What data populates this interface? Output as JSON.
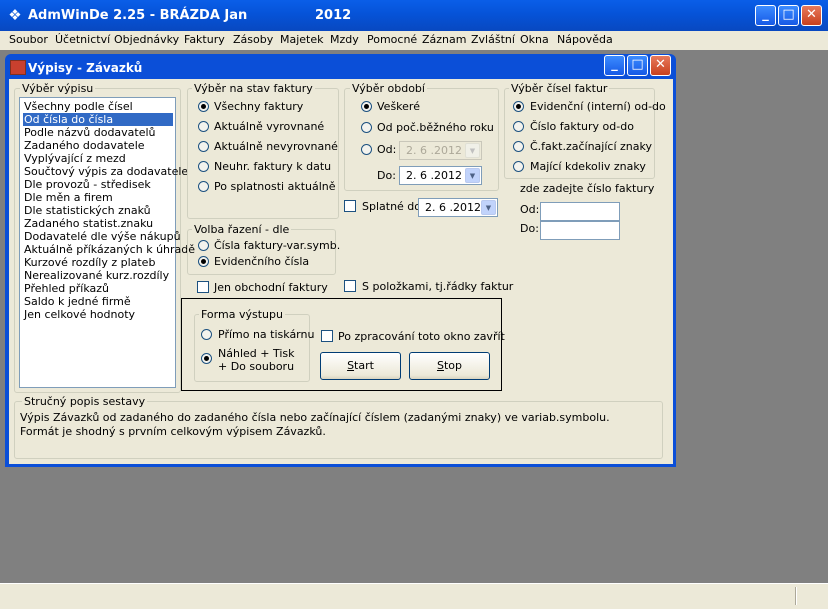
{
  "app": {
    "title": "AdmWinDe 2.25 - BRÁZDA Jan",
    "year": "2012",
    "icon": "app-logo-icon"
  },
  "window_controls": {
    "minimize": "_",
    "maximize": "□",
    "close": "✕"
  },
  "menu": [
    {
      "label": "Soubor"
    },
    {
      "label": "Účetnictví"
    },
    {
      "label": "Objednávky"
    },
    {
      "label": "Faktury"
    },
    {
      "label": "Zásoby"
    },
    {
      "label": "Majetek"
    },
    {
      "label": "Mzdy"
    },
    {
      "label": "Pomocné"
    },
    {
      "label": "Záznam"
    },
    {
      "label": "Zvláštní"
    },
    {
      "label": "Okna"
    },
    {
      "label": "Nápověda"
    }
  ],
  "dialog": {
    "title": "Výpisy - Závazků",
    "report_select": {
      "legend": "Výběr výpisu",
      "items": [
        "Všechny podle čísel",
        "Od čísla do čísla",
        "Podle názvů dodavatelů",
        "Zadaného dodavatele",
        "Vyplývající z mezd",
        "Součtový výpis za dodavatele",
        "Dle provozů - středisek",
        "Dle měn a firem",
        "Dle statistických znaků",
        "Zadaného statist.znaku",
        "Dodavatelé dle výše nákupů",
        "Aktuálně příkázaných k úhradě",
        "Kurzové rozdíly z plateb",
        "Nerealizované kurz.rozdíly",
        "Přehled příkazů",
        "Saldo k jedné firmě",
        "Jen celkové hodnoty"
      ],
      "selected_index": 1
    },
    "invoice_state": {
      "legend": "Výběr na stav faktury",
      "options": [
        "Všechny faktury",
        "Aktuálně vyrovnané",
        "Aktuálně nevyrovnané",
        "Neuhr. faktury k datu",
        "Po splatnosti aktuálně"
      ],
      "selected_index": 0
    },
    "period": {
      "legend": "Výběr období",
      "opt_all": "Veškeré",
      "opt_start": "Od poč.běžného roku",
      "opt_from": "Od:",
      "from_value": "2. 6 .2012",
      "to_label": "Do:",
      "to_value": "2. 6 .2012",
      "selected": "all"
    },
    "invoice_numbers": {
      "legend": "Výběr čísel faktur",
      "options": [
        "Evidenční (interní) od-do",
        "Číslo faktury od-do",
        "Č.fakt.začínající znaky",
        "Mající kdekoliv znaky"
      ],
      "selected_index": 0,
      "enter_hint": "zde zadejte číslo faktury",
      "from_label": "Od:",
      "from_value": "",
      "to_label": "Do:",
      "to_value": ""
    },
    "due": {
      "label": "Splatné do:",
      "value": "2. 6 .2012",
      "checked": false
    },
    "sort": {
      "legend": "Volba řazení - dle",
      "options": [
        "Čísla faktury-var.symb.",
        "Evidenčního čísla"
      ],
      "selected_index": 1
    },
    "only_business": {
      "label": "Jen obchodní faktury",
      "checked": false
    },
    "with_items": {
      "label": "S položkami, tj.řádky faktur",
      "checked": false
    },
    "output": {
      "legend": "Forma výstupu",
      "opt_print": "Přímo na tiskárnu",
      "opt_preview_1": "Náhled + Tisk",
      "opt_preview_2": "+ Do souboru",
      "selected": "preview",
      "close_after": {
        "label": "Po zpracování toto okno zavřít",
        "checked": false
      },
      "start": {
        "label_u": "S",
        "label_rest": "tart"
      },
      "stop": {
        "label_u": "S",
        "label_rest": "top"
      }
    },
    "description": {
      "legend": "Stručný popis sestavy",
      "text": "Výpis Závazků od zadaného do zadaného čísla nebo začínající číslem (zadanými znaky) ve variab.symbolu. Formát je shodný s prvním celkovým výpisem Závazků."
    }
  }
}
